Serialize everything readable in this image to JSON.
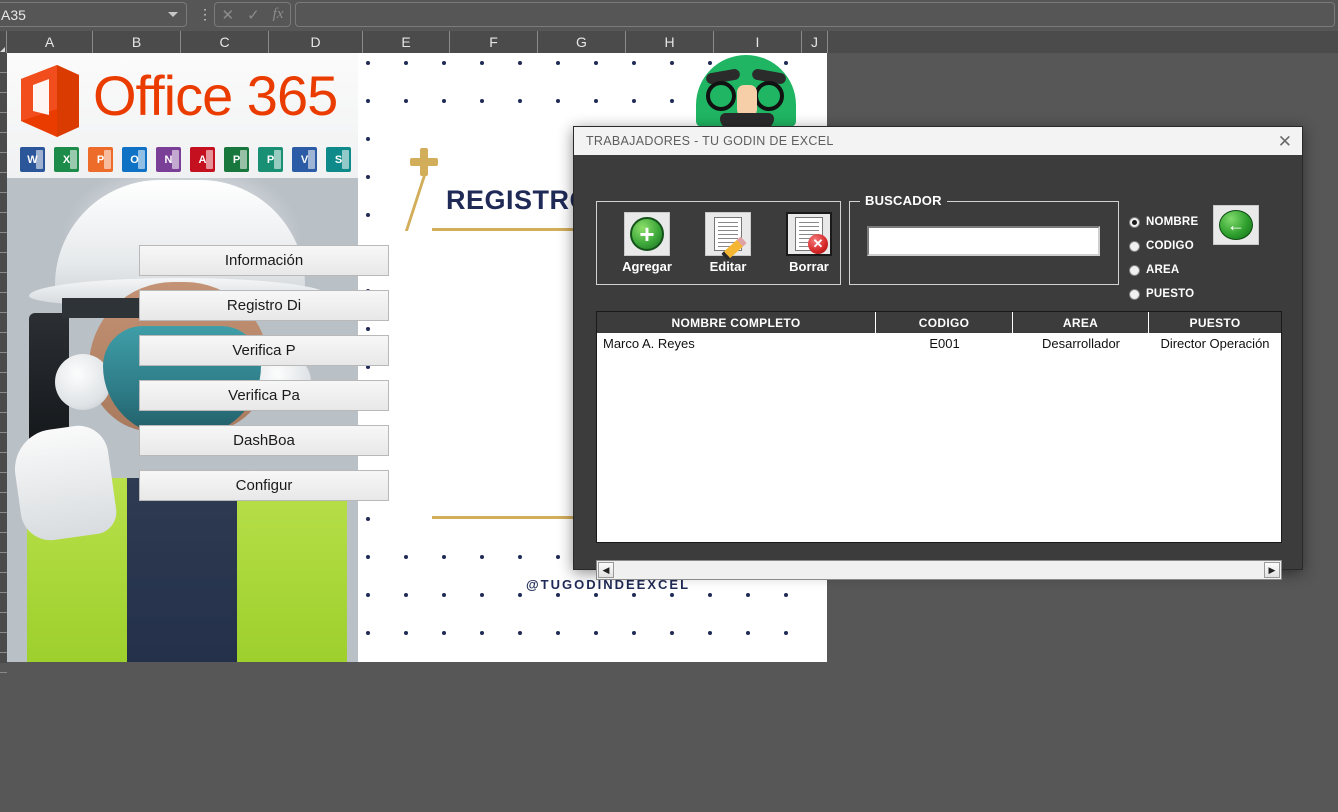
{
  "excel": {
    "name_box_value": "A35",
    "name_box_chevron": "chevron-down-icon",
    "kebab": "⋮",
    "formula_cancel": "✕",
    "formula_confirm": "✓",
    "formula_fx": "fx",
    "formula_value": "",
    "column_headers": [
      "A",
      "B",
      "C",
      "D",
      "E",
      "F",
      "G",
      "H",
      "I",
      "J"
    ]
  },
  "sheet": {
    "brand_text": "Office 365",
    "app_icons": [
      {
        "name": "word-icon",
        "letter": "W",
        "color": "#2b579a"
      },
      {
        "name": "excel-icon",
        "letter": "X",
        "color": "#1d8b4a"
      },
      {
        "name": "powerpoint-icon",
        "letter": "P",
        "color": "#ed6c29"
      },
      {
        "name": "outlook-icon",
        "letter": "O",
        "color": "#0f72c4"
      },
      {
        "name": "onenote-icon",
        "letter": "N",
        "color": "#7a3f97"
      },
      {
        "name": "access-icon",
        "letter": "A",
        "color": "#c5111f"
      },
      {
        "name": "publisher-icon",
        "letter": "P",
        "color": "#17773d"
      },
      {
        "name": "project-icon",
        "letter": "P",
        "color": "#198f73"
      },
      {
        "name": "visio-icon",
        "letter": "V",
        "color": "#2b5ca5"
      },
      {
        "name": "sharepoint-icon",
        "letter": "S",
        "color": "#0f8a8a"
      }
    ],
    "title": "REGISTRO DE",
    "handle": "@TUGODINDEEXCEL",
    "menu_buttons": [
      "Información",
      "Registro Di",
      "Verifica P",
      "Verifica Pa",
      "DashBoa",
      "Configur"
    ]
  },
  "dialog": {
    "title": "TRABAJADORES - TU GODIN DE EXCEL",
    "close_icon": "✕",
    "actions": [
      {
        "label": "Agregar",
        "icon": "add-circle-icon"
      },
      {
        "label": "Editar",
        "icon": "edit-document-icon"
      },
      {
        "label": "Borrar",
        "icon": "delete-document-icon"
      }
    ],
    "search": {
      "legend": "BUSCADOR",
      "value": "",
      "placeholder": ""
    },
    "filters": [
      {
        "label": "NOMBRE",
        "selected": true
      },
      {
        "label": "CODIGO",
        "selected": false
      },
      {
        "label": "AREA",
        "selected": false
      },
      {
        "label": "PUESTO",
        "selected": false
      }
    ],
    "back_button": {
      "icon": "back-arrow-icon",
      "glyph": "←"
    },
    "table": {
      "columns": [
        "NOMBRE COMPLETO",
        "CODIGO",
        "AREA",
        "PUESTO"
      ],
      "rows": [
        {
          "nombre_completo": "Marco A. Reyes",
          "codigo": "E001",
          "area": "Desarrollador",
          "puesto": "Director Operación"
        }
      ]
    },
    "scrollbar": {
      "left_arrow": "◀",
      "right_arrow": "▶"
    }
  }
}
